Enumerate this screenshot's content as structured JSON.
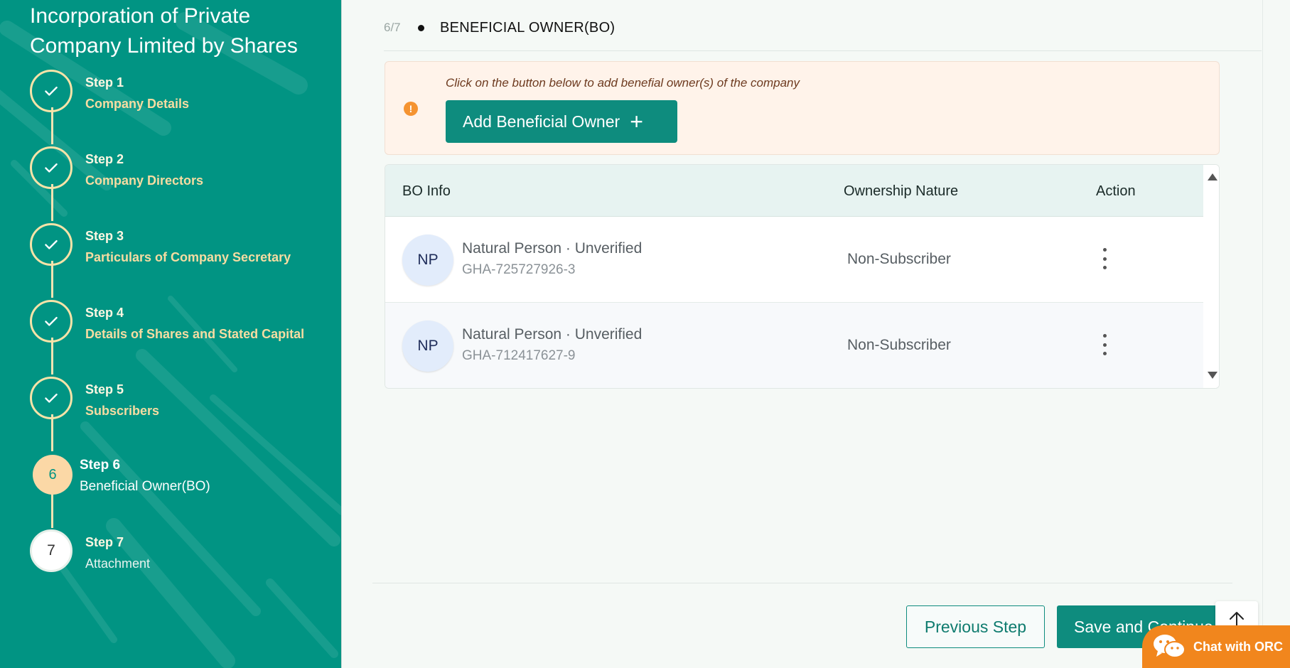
{
  "sidebar": {
    "title": "Incorporation of Private Company Limited by Shares",
    "steps": [
      {
        "number": "Step 1",
        "label": "Company Details",
        "status": "complete",
        "badge": ""
      },
      {
        "number": "Step 2",
        "label": "Company Directors",
        "status": "complete",
        "badge": ""
      },
      {
        "number": "Step 3",
        "label": "Particulars of Company Secretary",
        "status": "complete",
        "badge": ""
      },
      {
        "number": "Step 4",
        "label": "Details of Shares and Stated Capital",
        "status": "complete",
        "badge": ""
      },
      {
        "number": "Step 5",
        "label": "Subscribers",
        "status": "complete",
        "badge": ""
      },
      {
        "number": "Step 6",
        "label": "Beneficial Owner(BO)",
        "status": "current",
        "badge": "6"
      },
      {
        "number": "Step 7",
        "label": "Attachment",
        "status": "pending",
        "badge": "7"
      }
    ],
    "colors": {
      "background": "#019483",
      "accent": "#f6dca2"
    }
  },
  "section": {
    "counter": "6/7",
    "heading": "BENEFICIAL OWNER(BO)"
  },
  "notice": {
    "icon": "warning-icon",
    "message": "Click on the button below to add benefial owner(s) of the company",
    "button_label": "Add Beneficial Owner"
  },
  "table": {
    "headers": {
      "info": "BO Info",
      "nature": "Ownership Nature",
      "action": "Action"
    },
    "rows": [
      {
        "avatar": "NP",
        "title": "Natural Person · Unverified",
        "id": "GHA-725727926-3",
        "nature": "Non-Subscriber"
      },
      {
        "avatar": "NP",
        "title": "Natural Person · Unverified",
        "id": "GHA-712417627-9",
        "nature": "Non-Subscriber"
      }
    ]
  },
  "footer": {
    "previous_label": "Previous Step",
    "save_label": "Save and Continue",
    "chat_label": "Chat with ORC"
  }
}
